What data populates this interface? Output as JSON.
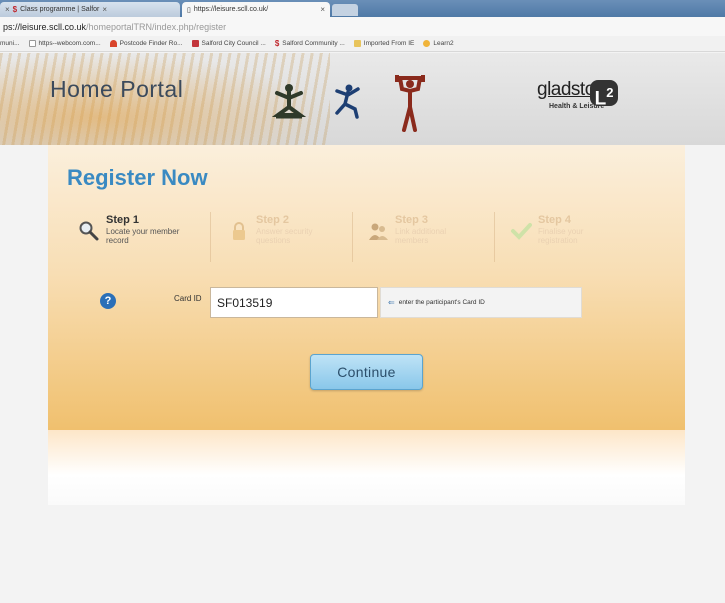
{
  "browser": {
    "tabs": [
      {
        "title": "Class programme | Salfor",
        "active": false
      },
      {
        "title": "https://leisure.scll.co.uk/",
        "active": true
      }
    ],
    "url_host": "ps://leisure.scll.co.uk",
    "url_path": "/homeportalTRN/index.php/register",
    "bookmarks": [
      {
        "label": "muni...",
        "icon": "page-icon"
      },
      {
        "label": "https--webcom.com...",
        "icon": "page-icon"
      },
      {
        "label": "Postcode Finder Ro...",
        "icon": "postcode-icon"
      },
      {
        "label": "Salford City Council ...",
        "icon": "council-icon"
      },
      {
        "label": "Salford Community ...",
        "icon": "dollar-icon"
      },
      {
        "label": "Imported From IE",
        "icon": "folder-icon"
      },
      {
        "label": "Learn2",
        "icon": "learn-icon"
      }
    ]
  },
  "header": {
    "title": "Home Portal",
    "brand": "gladstone",
    "brand_mark": "L",
    "brand_mark_sup": "2",
    "brand_sub": "Health & Leisure"
  },
  "page": {
    "title": "Register Now",
    "steps": [
      {
        "title": "Step 1",
        "desc": "Locate your member record",
        "active": true,
        "icon": "magnifier-icon"
      },
      {
        "title": "Step 2",
        "desc": "Answer security questions",
        "active": false,
        "icon": "lock-icon"
      },
      {
        "title": "Step 3",
        "desc": "Link additional members",
        "active": false,
        "icon": "people-icon"
      },
      {
        "title": "Step 4",
        "desc": "Finalise your registration",
        "active": false,
        "icon": "checkmark-icon"
      }
    ],
    "card_id_label": "Card ID",
    "card_id_value": "SF013519",
    "hint": "enter the participant's Card ID",
    "continue_label": "Continue"
  },
  "colors": {
    "title_blue": "#3a8ac2",
    "panel_orange": "#f0c06e",
    "help_blue": "#2a6fb8"
  }
}
